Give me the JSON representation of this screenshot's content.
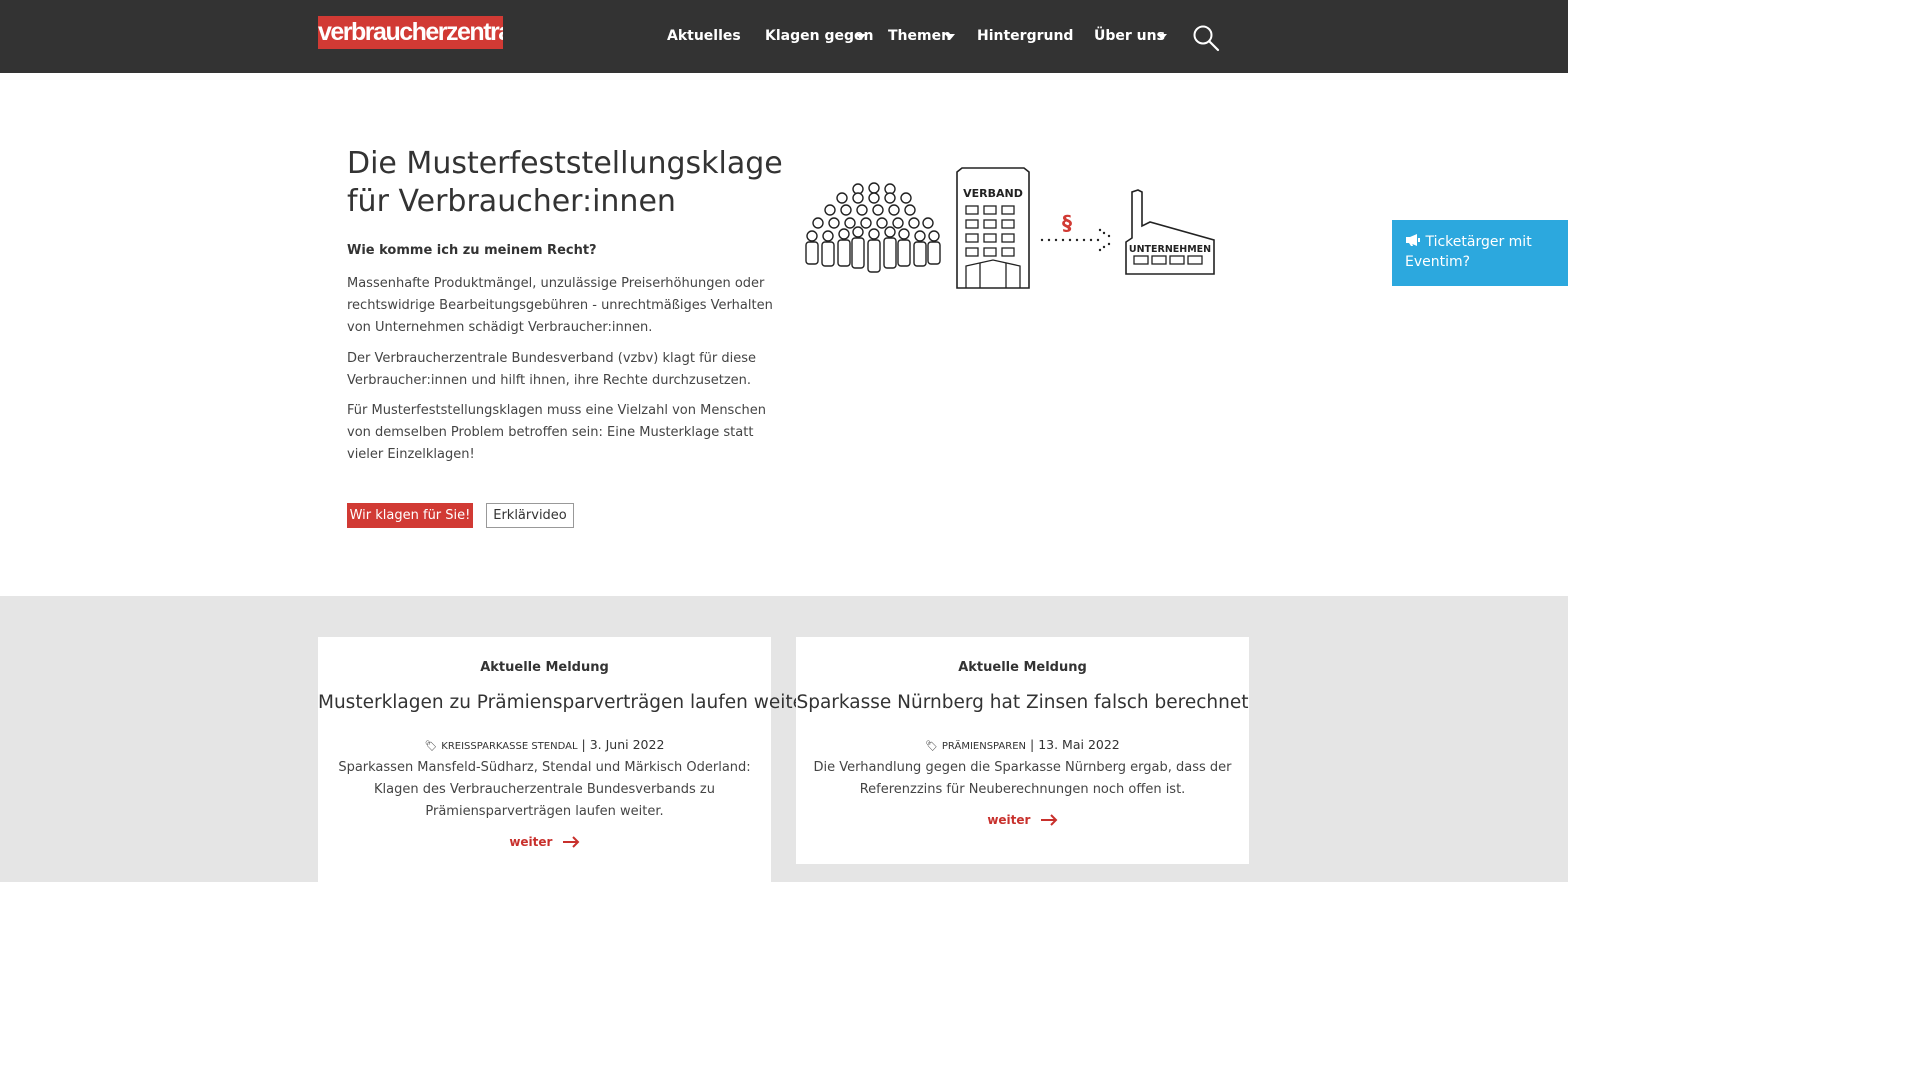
{
  "header": {
    "logo_text": "verbraucherzentrale",
    "nav": [
      {
        "label": "Aktuelles"
      },
      {
        "label": "Klagen gegen"
      },
      {
        "label": "Themen"
      },
      {
        "label": "Hintergrund"
      },
      {
        "label": "Über uns"
      }
    ],
    "search_icon": "search-icon"
  },
  "hero": {
    "title": "Die Musterfeststellungsklage für Verbraucher:innen",
    "question": "Wie komme ich zu meinem Recht?",
    "paragraphs": [
      "Massenhafte Produktmängel, unzulässige Preiserhöhungen oder rechtswidrige Bearbeitungsgebühren - unrechtmäßiges Verhalten von Unternehmen schädigt Verbraucher:innen.",
      "Der Verbraucherzentrale Bundesverband (vzbv) klagt für diese Verbraucher:innen und hilft ihnen, ihre Rechte durchzusetzen.",
      "Für Musterfeststellungsklagen muss eine Vielzahl von Menschen von demselben Problem betroffen sein: Eine Musterklage statt vieler Einzelklagen!"
    ],
    "primary_button": "Wir klagen für Sie!",
    "secondary_button": "Erklärvideo",
    "illustration": {
      "building_label": "VERBAND",
      "paragraph_sign": "§",
      "company_label": "UNTERNEHMEN"
    }
  },
  "side_banner": {
    "icon": "megaphone-icon",
    "text": "Ticketärger mit Eventim?"
  },
  "news": [
    {
      "kicker": "Aktuelle Meldung",
      "title": "Musterklagen zu Prämiensparverträgen laufen weiter!",
      "tag": "Kreissparkasse Stendal",
      "date": "3. Juni 2022",
      "text": "Sparkassen Mansfeld-Südharz, Stendal und Märkisch Oderland: Klagen des Verbraucherzentrale Bundesverbands zu Prämiensparverträgen laufen weiter.",
      "more": "weiter"
    },
    {
      "kicker": "Aktuelle Meldung",
      "title": "Sparkasse Nürnberg hat Zinsen falsch berechnet",
      "tag": "Prämiensparen",
      "date": "13. Mai 2022",
      "text": "Die Verhandlung gegen die Sparkasse Nürnberg ergab, dass der Referenzzins für Neuberechnungen noch offen ist.",
      "more": "weiter"
    }
  ],
  "colors": {
    "header_bg": "#333333",
    "brand_red": "#d13a34",
    "banner_blue": "#2ca8de",
    "section_grey": "#e5e5e5"
  }
}
